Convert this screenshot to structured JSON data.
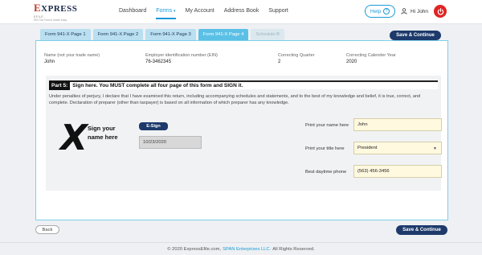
{
  "brand": {
    "logo_text": "EXPRESS",
    "logo_sub": "EFILE",
    "logo_tagline": "IRS Tax Forms made easy"
  },
  "nav": {
    "items": [
      {
        "label": "Dashboard"
      },
      {
        "label": "Forms"
      },
      {
        "label": "My Account"
      },
      {
        "label": "Address Book"
      },
      {
        "label": "Support"
      }
    ],
    "forms_caret": "▾"
  },
  "header": {
    "help_label": "Help",
    "help_icon_glyph": "?",
    "user_greeting": "Hi  John"
  },
  "tabs": [
    {
      "label": "Form 941-X Page 1"
    },
    {
      "label": "Form 941-X Page 2"
    },
    {
      "label": "Form 941-X Page 3"
    },
    {
      "label": "Form 941-X Page 4"
    },
    {
      "label": "Schedule B"
    }
  ],
  "save_continue_label": "Save & Continue",
  "info": {
    "name_label": "Name (not your trade name)",
    "name_value": "John",
    "ein_label": "Employer identification number (EIN)",
    "ein_value": "76-3462345",
    "quarter_label": "Correcting Quarter",
    "quarter_value": "2",
    "year_label": "Correcting Calender Year",
    "year_value": "2020"
  },
  "part5": {
    "label": "Part 5:",
    "title": "Sign here. You MUST complete all four page of this form and SIGN it.",
    "perjury_text": "Under penalties of perjury, I declare that I have examined this return, including accompanying schedules and statements, and to the best of my knowledge and belief, it is true, correct, and complete. Declaration of preparer (other than taxpayer) is based on all information of which preparer has any knowledge.",
    "sign_mark": "X",
    "sign_here_label": "Sign your name here",
    "esign_label": "E-Sign",
    "sign_date": "10/23/2020"
  },
  "fields": {
    "name_label": "Print your name here",
    "name_value": "John",
    "title_label": "Print your title here",
    "title_value": "President",
    "phone_label": "Best daytime phone",
    "phone_value": "(563) 456-3456"
  },
  "back_label": "Back",
  "footer": {
    "copyright": "© 2020 ExpressEfile.com,",
    "company": "SPAN Enterprises LLC.",
    "rights": "All Rights Reserved."
  },
  "colors": {
    "accent": "#1b9ad6",
    "primary_button": "#1d3a6b",
    "power_button": "#e02424",
    "active_tab": "#5bc0e6",
    "input_fill": "#fff9e0"
  }
}
